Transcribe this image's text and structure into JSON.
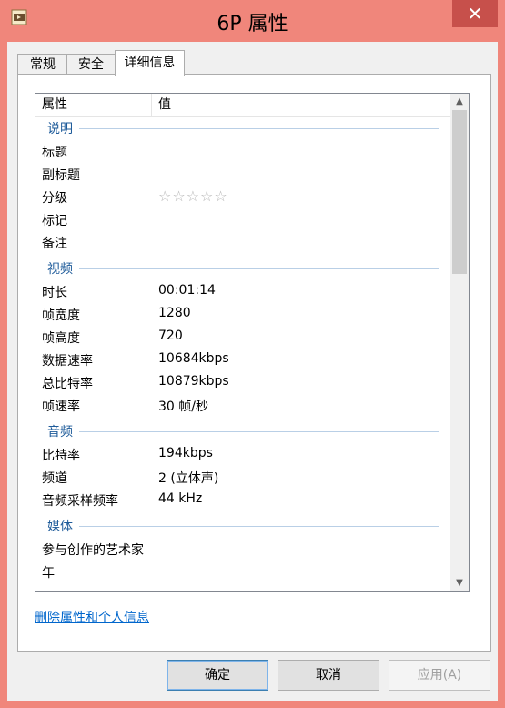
{
  "window": {
    "title": "6P 属性",
    "close_glyph": "✕",
    "app_icon": "video-file-icon"
  },
  "tabs": [
    {
      "label": "常规"
    },
    {
      "label": "安全"
    },
    {
      "label": "详细信息",
      "active": true
    }
  ],
  "details": {
    "columns": {
      "property": "属性",
      "value": "值"
    },
    "groups": {
      "description": "说明",
      "video": "视频",
      "audio": "音频",
      "media": "媒体"
    },
    "rows": {
      "title": {
        "k": "标题",
        "v": ""
      },
      "subtitle": {
        "k": "副标题",
        "v": ""
      },
      "rating": {
        "k": "分级",
        "stars": "☆☆☆☆☆",
        "rating_value": 0,
        "rating_max": 5
      },
      "tags": {
        "k": "标记",
        "v": ""
      },
      "comments": {
        "k": "备注",
        "v": ""
      },
      "length": {
        "k": "时长",
        "v": "00:01:14"
      },
      "frame_width": {
        "k": "帧宽度",
        "v": "1280"
      },
      "frame_height": {
        "k": "帧高度",
        "v": "720"
      },
      "data_rate": {
        "k": "数据速率",
        "v": "10684kbps"
      },
      "total_bitrate": {
        "k": "总比特率",
        "v": "10879kbps"
      },
      "frame_rate": {
        "k": "帧速率",
        "v": "30 帧/秒"
      },
      "bitrate": {
        "k": "比特率",
        "v": "194kbps"
      },
      "channels": {
        "k": "频道",
        "v": "2 (立体声)"
      },
      "sample_rate": {
        "k": "音频采样频率",
        "v": "44 kHz"
      },
      "contrib_artists": {
        "k": "参与创作的艺术家",
        "v": ""
      },
      "year": {
        "k": "年",
        "v": ""
      }
    }
  },
  "link": {
    "remove_props": "删除属性和个人信息"
  },
  "buttons": {
    "ok": "确定",
    "cancel": "取消",
    "apply": "应用(A)"
  },
  "colors": {
    "frame": "#f0867b",
    "close": "#c7504b",
    "group_text": "#1e5b9a",
    "link": "#0066cc"
  }
}
